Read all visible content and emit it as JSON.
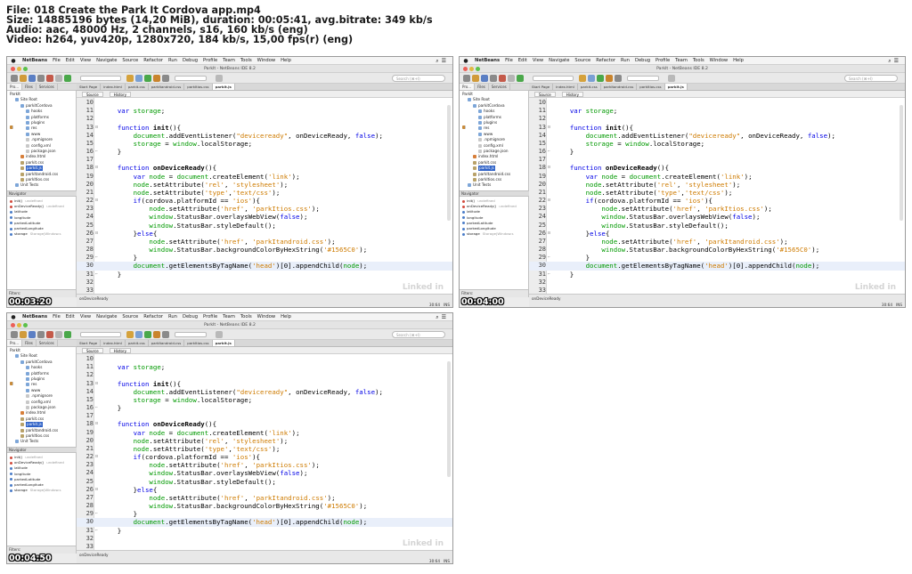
{
  "header": {
    "file": "File: 018 Create the Park It Cordova app.mp4",
    "size": "Size: 14885196 bytes (14,20 MiB), duration: 00:05:41, avg.bitrate: 349 kb/s",
    "audio": "Audio: aac, 48000 Hz, 2 channels, s16, 160 kb/s (eng)",
    "video": "Video: h264, yuv420p, 1280x720, 184 kb/s, 15,00 fps(r) (eng)"
  },
  "ide": {
    "menubar": [
      "NetBeans",
      "File",
      "Edit",
      "View",
      "Navigate",
      "Source",
      "Refactor",
      "Run",
      "Debug",
      "Profile",
      "Team",
      "Tools",
      "Window",
      "Help"
    ],
    "window_title": "ParkIt - NetBeans IDE 8.2",
    "search_placeholder": "Search (⌘+I)",
    "left_tabs": [
      "Pro...",
      "Files",
      "Services"
    ],
    "project_tree": [
      {
        "label": "ParkIt",
        "depth": 0,
        "icon": "project-icon"
      },
      {
        "label": "Site Root",
        "depth": 1,
        "icon": "folder-icon"
      },
      {
        "label": "parkitCordova",
        "depth": 2,
        "icon": "folder-icon"
      },
      {
        "label": "hooks",
        "depth": 3,
        "icon": "folder-icon"
      },
      {
        "label": "platforms",
        "depth": 3,
        "icon": "folder-icon"
      },
      {
        "label": "plugins",
        "depth": 3,
        "icon": "folder-icon"
      },
      {
        "label": "res",
        "depth": 3,
        "icon": "folder-icon"
      },
      {
        "label": "www",
        "depth": 3,
        "icon": "folder-icon"
      },
      {
        "label": ".npmignore",
        "depth": 3,
        "icon": "file-icon"
      },
      {
        "label": "config.xml",
        "depth": 3,
        "icon": "file-icon"
      },
      {
        "label": "package.json",
        "depth": 3,
        "icon": "file-icon"
      },
      {
        "label": "index.html",
        "depth": 2,
        "icon": "html-file-icon"
      },
      {
        "label": "parkit.css",
        "depth": 2,
        "icon": "css-file-icon"
      },
      {
        "label": "parkit.js",
        "depth": 2,
        "icon": "js-file-icon",
        "selected": true
      },
      {
        "label": "parkItandroid.css",
        "depth": 2,
        "icon": "css-file-icon"
      },
      {
        "label": "parkItios.css",
        "depth": 2,
        "icon": "css-file-icon"
      },
      {
        "label": "Unit Tests",
        "depth": 1,
        "icon": "folder-icon"
      }
    ],
    "navigator_title": "Navigator",
    "navigator": [
      {
        "name": "init()",
        "type": "undefined"
      },
      {
        "name": "onDeviceReady()",
        "type": "undefined"
      },
      {
        "name": "latitude",
        "type": ""
      },
      {
        "name": "longitude",
        "type": ""
      },
      {
        "name": "parkedLatitude",
        "type": ""
      },
      {
        "name": "parkedLongitude",
        "type": ""
      },
      {
        "name": "storage",
        "type": "Storage|Window.s"
      }
    ],
    "filters_label": "Filters:",
    "editor_tabs": [
      "Start Page",
      "index.html",
      "parkit.css",
      "parkItandroid.css",
      "parkItios.css",
      "parkit.js"
    ],
    "editor_modes": [
      "Source",
      "History"
    ],
    "code_lines": [
      {
        "n": "10",
        "t": ""
      },
      {
        "n": "11",
        "t": "    var storage;"
      },
      {
        "n": "12",
        "t": ""
      },
      {
        "n": "13",
        "t": "    function init(){"
      },
      {
        "n": "14",
        "t": "        document.addEventListener(\"deviceready\", onDeviceReady, false);"
      },
      {
        "n": "15",
        "t": "        storage = window.localStorage;"
      },
      {
        "n": "16",
        "t": "    }"
      },
      {
        "n": "17",
        "t": ""
      },
      {
        "n": "18",
        "t": "    function onDeviceReady(){"
      },
      {
        "n": "19",
        "t": "        var node = document.createElement('link');"
      },
      {
        "n": "20",
        "t": "        node.setAttribute('rel', 'stylesheet');"
      },
      {
        "n": "21",
        "t": "        node.setAttribute('type','text/css');"
      },
      {
        "n": "22",
        "t": "        if(cordova.platformId == 'ios'){"
      },
      {
        "n": "23",
        "t": "            node.setAttribute('href', 'parkItios.css');"
      },
      {
        "n": "24",
        "t": "            window.StatusBar.overlaysWebView(false);"
      },
      {
        "n": "25",
        "t": "            window.StatusBar.styleDefault();"
      },
      {
        "n": "26",
        "t": "        }else{"
      },
      {
        "n": "27",
        "t": "            node.setAttribute('href', 'parkItandroid.css');"
      },
      {
        "n": "28",
        "t": "            window.StatusBar.backgroundColorByHexString('#1565C0');"
      },
      {
        "n": "29",
        "t": "        }"
      },
      {
        "n": "30",
        "t": "        document.getElementsByTagName('head')[0].appendChild(node);"
      },
      {
        "n": "31",
        "t": "    }"
      },
      {
        "n": "32",
        "t": ""
      },
      {
        "n": "33",
        "t": ""
      }
    ],
    "status_crumb": "onDeviceReady",
    "cursor_pos": "30:64",
    "insert_mode": "INS",
    "watermark": "Linked in"
  },
  "frames": [
    {
      "timestamp": "00:03:20"
    },
    {
      "timestamp": "00:04:00"
    },
    {
      "timestamp": "00:04:50"
    }
  ],
  "colors": {
    "keyword": "#0000e6",
    "string": "#ce7b00",
    "selection": "#2f62c7",
    "highlight_line": "#e9effa"
  }
}
